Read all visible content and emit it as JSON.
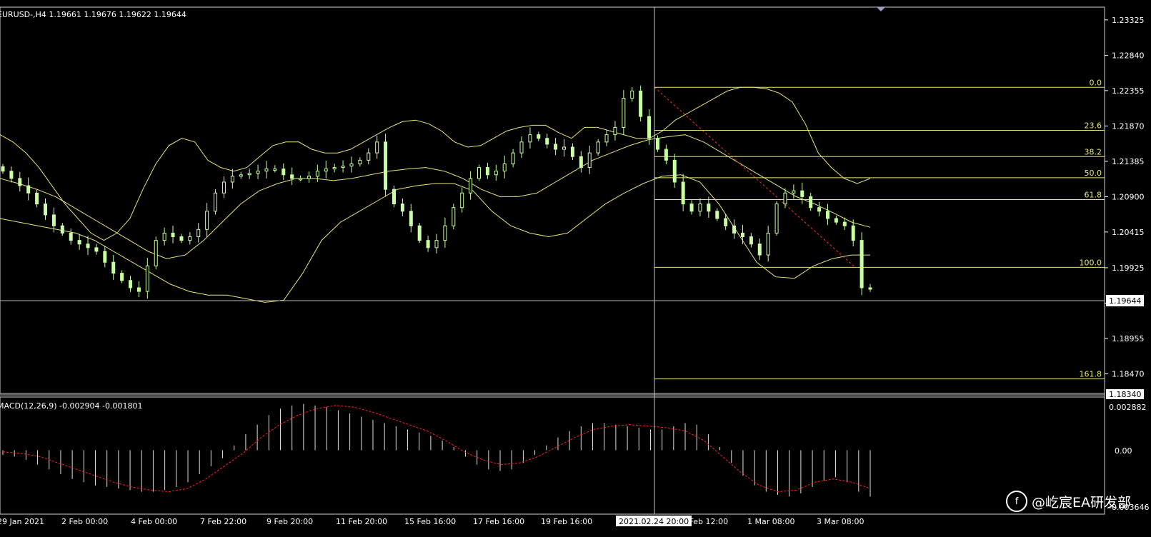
{
  "header": {
    "symbol_line": "EURUSD-,H4  1.19661 1.19676 1.19622 1.19644"
  },
  "macd": {
    "label": "MACD(12,26,9) -0.002904 -0.001801",
    "scale_top": "0.002882",
    "scale_zero": "0.00",
    "scale_bottom": "-0.003646"
  },
  "price_scale": [
    "1.23325",
    "1.22840",
    "1.22355",
    "1.21870",
    "1.21385",
    "1.20900",
    "1.20415",
    "1.19925",
    "1.19440",
    "1.18955",
    "1.18470"
  ],
  "current_price": "1.19644",
  "crosshair_price": "1.18340",
  "crosshair_time": "2021.02.24 20:00",
  "time_axis": [
    "29 Jan 2021",
    "2 Feb 00:00",
    "4 Feb 00:00",
    "7 Feb 22:00",
    "9 Feb 20:00",
    "11 Feb 20:00",
    "15 Feb 16:00",
    "17 Feb 16:00",
    "19 Feb 16:00",
    "24 Feb 20:00",
    "26 Feb 12:00",
    "1 Mar 08:00",
    "3 Mar 08:00"
  ],
  "fibonacci": {
    "levels": [
      {
        "label": "0.0",
        "price": 1.224
      },
      {
        "label": "23.6",
        "price": 1.2181
      },
      {
        "label": "38.2",
        "price": 1.2145
      },
      {
        "label": "50.0",
        "price": 1.2116
      },
      {
        "label": "61.8",
        "price": 1.2086
      },
      {
        "label": "100.0",
        "price": 1.1993
      },
      {
        "label": "161.8",
        "price": 1.184
      }
    ]
  },
  "watermark": {
    "logo_glyph": "f",
    "text": "@屹宸EA研发部"
  },
  "colors": {
    "candle": "#c8ffa0",
    "bollinger": "#e6e678",
    "fib": "#e6e678",
    "crosshair": "#c8c8c8",
    "macd_hist": "#e0e0e0",
    "macd_signal": "#ff2020"
  },
  "chart_data": {
    "type": "candlestick",
    "symbol": "EURUSD-",
    "timeframe": "H4",
    "ylim": [
      1.182,
      1.235
    ],
    "close_path": [
      1.2125,
      1.2115,
      1.2105,
      1.2095,
      1.208,
      1.2065,
      1.205,
      1.204,
      1.203,
      1.2025,
      1.202,
      1.2015,
      1.2,
      1.1985,
      1.1975,
      1.1965,
      1.196,
      1.1995,
      1.203,
      1.204,
      1.2035,
      1.203,
      1.2035,
      1.2045,
      1.207,
      1.2095,
      1.211,
      1.2118,
      1.212,
      1.2122,
      1.2125,
      1.2128,
      1.2128,
      1.212,
      1.2115,
      1.2115,
      1.2118,
      1.2125,
      1.2128,
      1.213,
      1.2132,
      1.2135,
      1.214,
      1.215,
      1.2165,
      1.21,
      1.208,
      1.207,
      1.205,
      1.203,
      1.202,
      1.203,
      1.205,
      1.2075,
      1.2095,
      1.2115,
      1.213,
      1.212,
      1.2125,
      1.2135,
      1.215,
      1.2165,
      1.2175,
      1.217,
      1.2162,
      1.2155,
      1.2158,
      1.2145,
      1.213,
      1.215,
      1.2165,
      1.2175,
      1.2185,
      1.2225,
      1.2235,
      1.22,
      1.217,
      1.2155,
      1.214,
      1.211,
      1.208,
      1.207,
      1.208,
      1.207,
      1.206,
      1.205,
      1.204,
      1.2035,
      1.2025,
      1.201,
      1.204,
      1.208,
      1.2095,
      1.2098,
      1.209,
      1.2075,
      1.207,
      1.206,
      1.2055,
      1.205,
      1.203,
      1.1965,
      1.1964
    ],
    "bollinger_upper": [
      1.2175,
      1.2165,
      1.215,
      1.213,
      1.2105,
      1.208,
      1.206,
      1.204,
      1.203,
      1.204,
      1.206,
      1.21,
      1.2135,
      1.216,
      1.217,
      1.2165,
      1.214,
      1.213,
      1.2125,
      1.213,
      1.2145,
      1.216,
      1.2165,
      1.2165,
      1.2155,
      1.215,
      1.215,
      1.2155,
      1.2165,
      1.2175,
      1.2185,
      1.2193,
      1.2195,
      1.219,
      1.218,
      1.2165,
      1.2158,
      1.216,
      1.217,
      1.218,
      1.2185,
      1.2188,
      1.2188,
      1.2178,
      1.217,
      1.2185,
      1.2185,
      1.218,
      1.2175,
      1.217,
      1.217,
      1.218,
      1.2195,
      1.2205,
      1.2215,
      1.2225,
      1.2235,
      1.224,
      1.224,
      1.2238,
      1.2232,
      1.222,
      1.219,
      1.215,
      1.213,
      1.2115,
      1.2108,
      1.2115
    ],
    "bollinger_middle": [
      1.2115,
      1.2108,
      1.21,
      1.209,
      1.2075,
      1.206,
      1.2045,
      1.203,
      1.2015,
      1.2005,
      1.201,
      1.203,
      1.2055,
      1.208,
      1.2098,
      1.2108,
      1.2115,
      1.2115,
      1.2112,
      1.2115,
      1.212,
      1.2125,
      1.2128,
      1.213,
      1.2125,
      1.2115,
      1.21,
      1.209,
      1.209,
      1.2095,
      1.211,
      1.2125,
      1.214,
      1.215,
      1.216,
      1.2168,
      1.2172,
      1.2175,
      1.2165,
      1.215,
      1.2135,
      1.212,
      1.2105,
      1.209,
      1.208,
      1.2068,
      1.2055,
      1.2048
    ],
    "bollinger_lower": [
      1.206,
      1.2055,
      1.205,
      1.2045,
      1.204,
      1.203,
      1.2015,
      1.2,
      1.1985,
      1.197,
      1.196,
      1.1955,
      1.1955,
      1.195,
      1.1945,
      1.1948,
      1.1985,
      1.203,
      1.2055,
      1.207,
      1.2085,
      1.21,
      1.2105,
      1.2108,
      1.2108,
      1.2098,
      1.207,
      1.205,
      1.204,
      1.2035,
      1.204,
      1.206,
      1.208,
      1.2095,
      1.2108,
      1.2118,
      1.212,
      1.211,
      1.208,
      1.204,
      1.2,
      1.198,
      1.1978,
      1.1995,
      1.2005,
      1.201,
      1.201
    ],
    "macd_histogram": [
      -0.0003,
      -0.0004,
      -0.0006,
      -0.0009,
      -0.0012,
      -0.0015,
      -0.0018,
      -0.002,
      -0.0022,
      -0.0023,
      -0.0024,
      -0.0025,
      -0.0026,
      -0.0026,
      -0.0025,
      -0.0023,
      -0.002,
      -0.0015,
      -0.001,
      -0.0005,
      0.0003,
      0.001,
      0.0016,
      0.0022,
      0.0026,
      0.0028,
      0.0029,
      0.0028,
      0.0027,
      0.0025,
      0.0023,
      0.0021,
      0.0019,
      0.0017,
      0.0015,
      0.0013,
      0.0011,
      0.0009,
      0.0006,
      0.0002,
      -0.0004,
      -0.0009,
      -0.0012,
      -0.0013,
      -0.0012,
      -0.0008,
      -0.0003,
      0.0003,
      0.0008,
      0.0012,
      0.0015,
      0.0017,
      0.0017,
      0.0016,
      0.0015,
      0.0014,
      0.0013,
      0.0013,
      0.0015,
      0.0017,
      0.0016,
      0.001,
      0.0002,
      -0.0008,
      -0.0016,
      -0.0022,
      -0.0026,
      -0.0028,
      -0.0029,
      -0.0027,
      -0.0023,
      -0.0019,
      -0.0017,
      -0.002,
      -0.0026,
      -0.0029
    ],
    "macd_signal": [
      -0.0001,
      -0.0002,
      -0.0004,
      -0.0008,
      -0.0012,
      -0.0016,
      -0.002,
      -0.0023,
      -0.0025,
      -0.0026,
      -0.0024,
      -0.0018,
      -0.001,
      -0.0002,
      0.0008,
      0.0016,
      0.0022,
      0.0026,
      0.0028,
      0.0027,
      0.0024,
      0.002,
      0.0016,
      0.0012,
      0.0006,
      -0.0001,
      -0.0006,
      -0.0009,
      -0.0008,
      -0.0004,
      0.0002,
      0.0008,
      0.0013,
      0.0015,
      0.0016,
      0.0015,
      0.0014,
      0.0012,
      0.0006,
      -0.0004,
      -0.0014,
      -0.0022,
      -0.0026,
      -0.0025,
      -0.002,
      -0.0018,
      -0.002,
      -0.0024
    ]
  }
}
